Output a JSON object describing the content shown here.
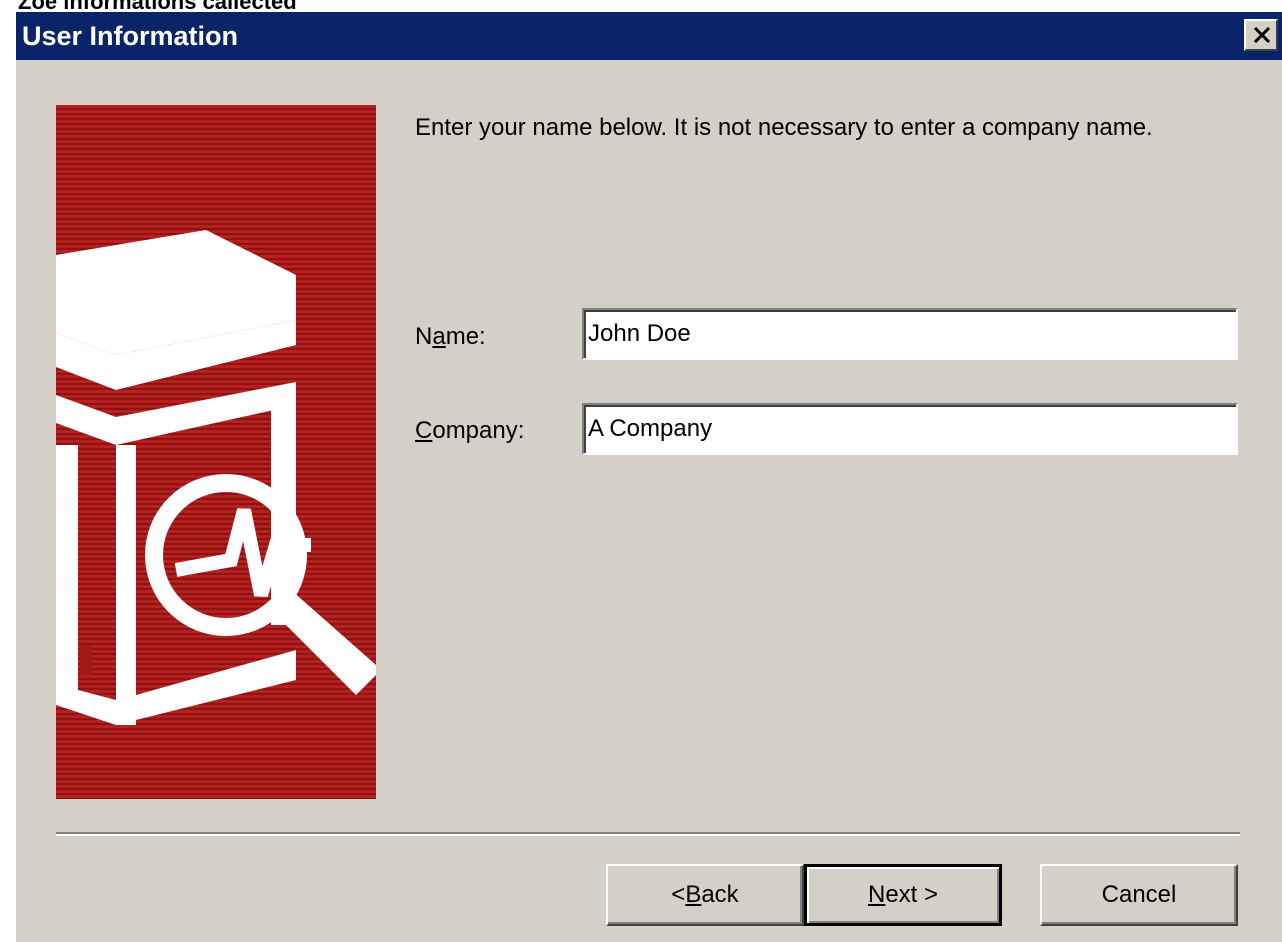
{
  "caption": "Zoe informations callected",
  "window": {
    "title": "User Information",
    "close_label": "Close"
  },
  "instruction": "Enter your name below.  It is not necessary to enter a company name.",
  "form": {
    "name_label_pre": "N",
    "name_label_u": "a",
    "name_label_post": "me:",
    "name_value": "John Doe",
    "company_label_pre": "",
    "company_label_u": "C",
    "company_label_post": "ompany:",
    "company_value": "A Company"
  },
  "buttons": {
    "back_pre": "< ",
    "back_u": "B",
    "back_post": "ack",
    "next_pre": "",
    "next_u": "N",
    "next_post": "ext >",
    "cancel": "Cancel"
  },
  "icons": {
    "graphic": "server-magnifier-graphic",
    "close": "close-icon"
  },
  "colors": {
    "titlebar": "#0a246a",
    "dialog_bg": "#d4d0c8",
    "graphic_red": "#a01a1a"
  }
}
